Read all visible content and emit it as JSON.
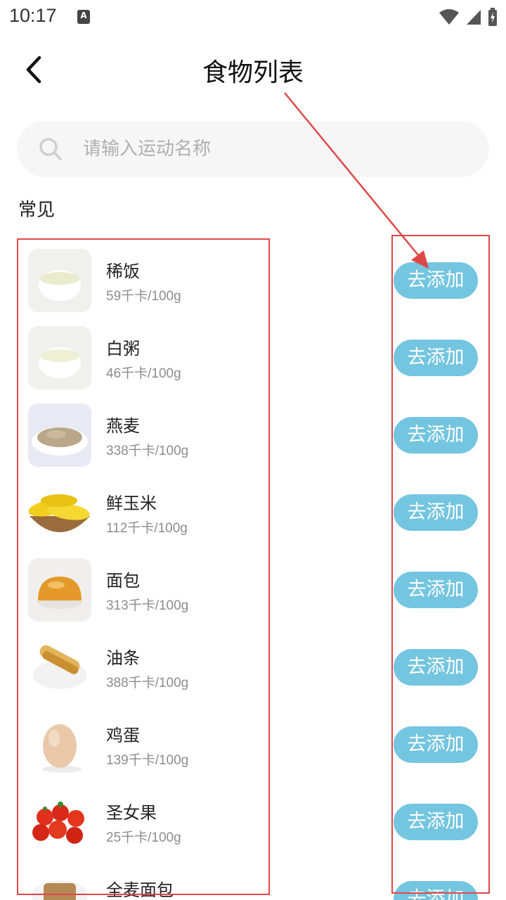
{
  "status_bar": {
    "time": "10:17",
    "notif_letter": "A"
  },
  "header": {
    "title": "食物列表"
  },
  "search": {
    "placeholder": "请输入运动名称",
    "value": ""
  },
  "section": {
    "title": "常见"
  },
  "add_label": "去添加",
  "foods": [
    {
      "name": "稀饭",
      "kcal": "59千卡/100g",
      "icon": "rice-porridge-bowl-icon"
    },
    {
      "name": "白粥",
      "kcal": "46千卡/100g",
      "icon": "white-congee-bowl-icon"
    },
    {
      "name": "燕麦",
      "kcal": "338千卡/100g",
      "icon": "oats-plate-icon"
    },
    {
      "name": "鲜玉米",
      "kcal": "112千卡/100g",
      "icon": "corn-basket-icon"
    },
    {
      "name": "面包",
      "kcal": "313千卡/100g",
      "icon": "bread-roll-icon"
    },
    {
      "name": "油条",
      "kcal": "388千卡/100g",
      "icon": "fried-dough-stick-icon"
    },
    {
      "name": "鸡蛋",
      "kcal": "139千卡/100g",
      "icon": "egg-icon"
    },
    {
      "name": "圣女果",
      "kcal": "25千卡/100g",
      "icon": "cherry-tomatoes-icon"
    },
    {
      "name": "全麦面包",
      "kcal": "",
      "icon": "whole-wheat-bread-icon"
    }
  ],
  "colors": {
    "add_button": "#74c5df",
    "annotation": "#df4848",
    "search_bg": "#f6f6f6"
  }
}
